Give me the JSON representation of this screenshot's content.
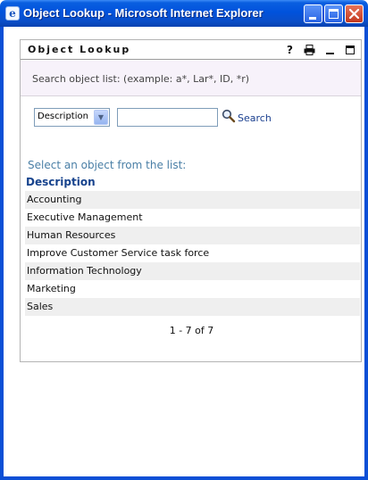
{
  "window": {
    "title": "Object Lookup - Microsoft Internet Explorer",
    "icon": "ie-page-icon"
  },
  "portlet": {
    "title": "Object Lookup",
    "header_icons": [
      "help-icon",
      "print-icon",
      "minimize-icon",
      "maximize-icon"
    ],
    "help_glyph": "?"
  },
  "search": {
    "hint": "Search object list: (example: a*, Lar*, ID, *r)",
    "field_selected": "Description",
    "input_value": "",
    "button_label": "Search"
  },
  "list": {
    "instruction": "Select an object from the list:",
    "column_header": "Description",
    "items": [
      "Accounting",
      "Executive Management",
      "Human Resources",
      "Improve Customer Service task force",
      "Information Technology",
      "Marketing",
      "Sales"
    ]
  },
  "pager": {
    "text": "1 - 7 of 7"
  },
  "colors": {
    "titlebar": "#0052dc",
    "link": "#1a3f8f",
    "instruction": "#4a7fa6",
    "header": "#17438d",
    "row_stripe": "#efefef"
  }
}
